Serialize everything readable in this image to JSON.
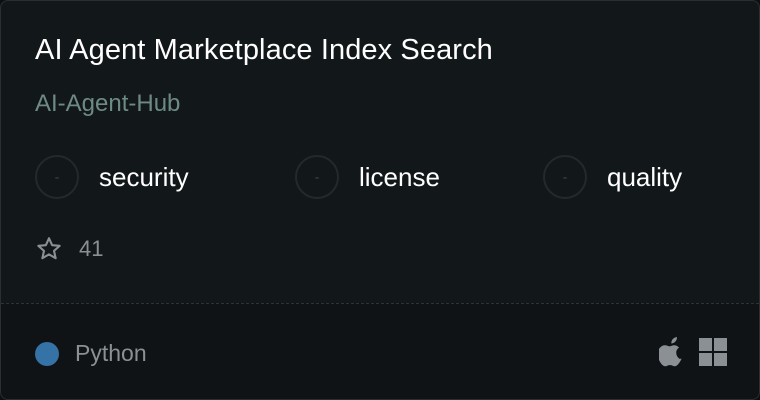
{
  "card": {
    "title": "AI Agent Marketplace Index Search",
    "owner": "AI-Agent-Hub",
    "metrics": [
      {
        "score": "-",
        "label": "security"
      },
      {
        "score": "-",
        "label": "license"
      },
      {
        "score": "-",
        "label": "quality"
      }
    ],
    "stars": "41",
    "star_icon": "star-outline-icon",
    "language": {
      "name": "Python",
      "color": "#3572a5"
    },
    "platforms": [
      "apple-icon",
      "windows-icon"
    ],
    "colors": {
      "background": "#121719",
      "owner": "#6e8a86",
      "muted_text": "#8a9094",
      "icon": "#8a9094"
    }
  }
}
